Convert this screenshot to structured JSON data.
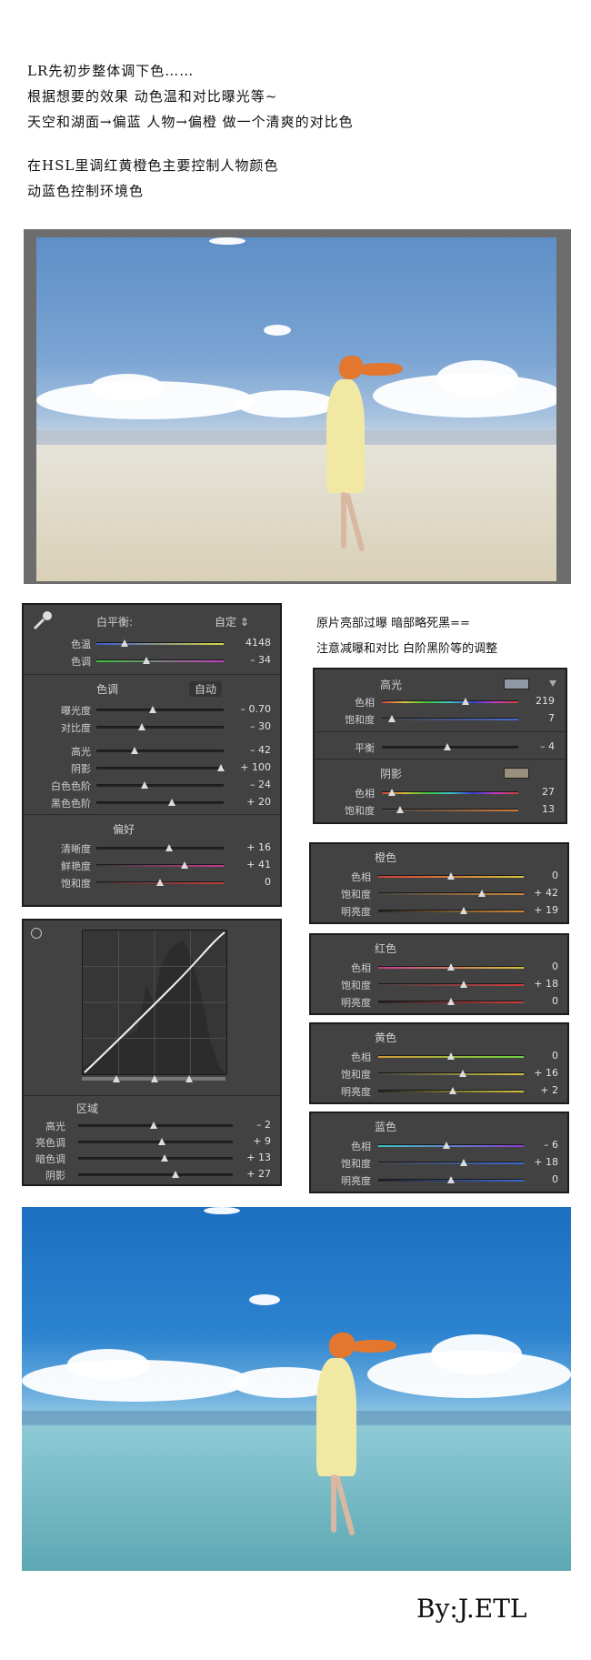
{
  "intro": {
    "lines": [
      "LR先初步整体调下色……",
      "根据想要的效果 动色温和对比曝光等~",
      "天空和湖面→偏蓝 人物→偏橙 做一个清爽的对比色",
      "在HSL里调红黄橙色主要控制人物颜色",
      "动蓝色控制环境色"
    ]
  },
  "note": {
    "lines": [
      "原片亮部过曝 暗部略死黑==",
      "注意减曝和对比 白阶黑阶等的调整"
    ]
  },
  "basic": {
    "wb_label": "白平衡:",
    "wb_value": "自定 ⇕",
    "temp_label": "色温",
    "temp_value": "4148",
    "temp_pos": 0.22,
    "tint_label": "色调",
    "tint_value": "– 34",
    "tint_pos": 0.39,
    "tone_label": "色调",
    "auto_label": "自动",
    "rows": [
      {
        "label": "曝光度",
        "value": "– 0.70",
        "pos": 0.44
      },
      {
        "label": "对比度",
        "value": "– 30",
        "pos": 0.36
      },
      {
        "label": "高光",
        "value": "– 42",
        "pos": 0.3
      },
      {
        "label": "阴影",
        "value": "+ 100",
        "pos": 0.98
      },
      {
        "label": "白色色阶",
        "value": "– 24",
        "pos": 0.38
      },
      {
        "label": "黑色色阶",
        "value": "+ 20",
        "pos": 0.59
      }
    ],
    "presence_label": "偏好",
    "presence_rows": [
      {
        "label": "清晰度",
        "value": "+ 16",
        "pos": 0.57
      },
      {
        "label": "鲜艳度",
        "value": "+ 41",
        "pos": 0.69
      },
      {
        "label": "饱和度",
        "value": "0",
        "pos": 0.5
      }
    ]
  },
  "split": {
    "hl_label": "高光",
    "hl_hue_label": "色相",
    "hl_hue_value": "219",
    "hl_hue_pos": 0.61,
    "hl_sat_label": "饱和度",
    "hl_sat_value": "7",
    "hl_sat_pos": 0.07,
    "bal_label": "平衡",
    "bal_value": "– 4",
    "bal_pos": 0.48,
    "sh_label": "阴影",
    "sh_hue_label": "色相",
    "sh_hue_value": "27",
    "sh_hue_pos": 0.07,
    "sh_sat_label": "饱和度",
    "sh_sat_value": "13",
    "sh_sat_pos": 0.13
  },
  "curve": {
    "region_label": "区域",
    "rows": [
      {
        "label": "高光",
        "value": "– 2",
        "pos": 0.49
      },
      {
        "label": "亮色调",
        "value": "+ 9",
        "pos": 0.54
      },
      {
        "label": "暗色调",
        "value": "+ 13",
        "pos": 0.56
      },
      {
        "label": "阴影",
        "value": "+ 27",
        "pos": 0.63
      }
    ]
  },
  "hsl": [
    {
      "title": "橙色",
      "rows": [
        {
          "label": "色相",
          "value": "0",
          "pos": 0.5
        },
        {
          "label": "饱和度",
          "value": "+ 42",
          "pos": 0.71
        },
        {
          "label": "明亮度",
          "value": "+ 19",
          "pos": 0.59
        }
      ]
    },
    {
      "title": "红色",
      "rows": [
        {
          "label": "色相",
          "value": "0",
          "pos": 0.5
        },
        {
          "label": "饱和度",
          "value": "+ 18",
          "pos": 0.59
        },
        {
          "label": "明亮度",
          "value": "0",
          "pos": 0.5
        }
      ]
    },
    {
      "title": "黄色",
      "rows": [
        {
          "label": "色相",
          "value": "0",
          "pos": 0.5
        },
        {
          "label": "饱和度",
          "value": "+ 16",
          "pos": 0.58
        },
        {
          "label": "明亮度",
          "value": "+ 2",
          "pos": 0.51
        }
      ]
    },
    {
      "title": "蓝色",
      "rows": [
        {
          "label": "色相",
          "value": "– 6",
          "pos": 0.47
        },
        {
          "label": "饱和度",
          "value": "+ 18",
          "pos": 0.59
        },
        {
          "label": "明亮度",
          "value": "0",
          "pos": 0.5
        }
      ]
    }
  ],
  "signature": "By:J.ETL",
  "colors": {
    "panel_bg": "#424242",
    "temp_track": "linear-gradient(90deg,#3d5bd0,#d8d840)",
    "tint_track": "linear-gradient(90deg,#39c23c,#c43cc4)"
  }
}
